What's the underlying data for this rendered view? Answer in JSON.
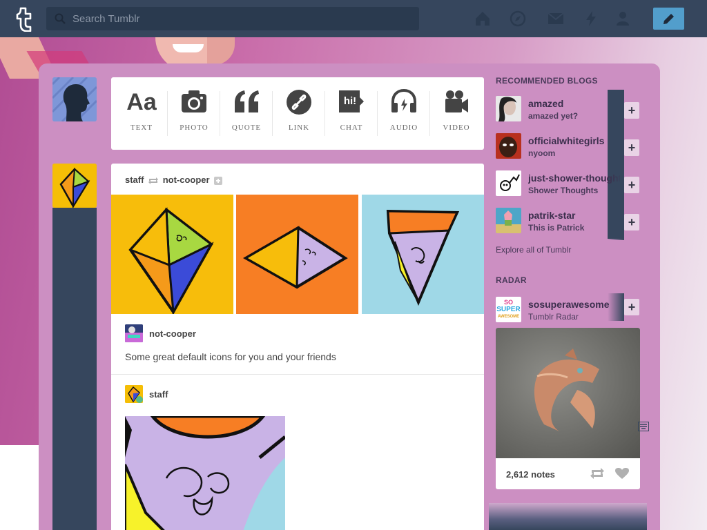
{
  "header": {
    "search_placeholder": "Search Tumblr",
    "nav_icons": [
      "home-icon",
      "explore-icon",
      "inbox-icon",
      "activity-icon",
      "account-icon"
    ],
    "compose_icon": "pencil-icon",
    "colors": {
      "header_bg": "#36465d",
      "compose_bg": "#529ecc"
    }
  },
  "composer": {
    "types": [
      {
        "id": "text",
        "label": "TEXT",
        "icon": "text-icon"
      },
      {
        "id": "photo",
        "label": "PHOTO",
        "icon": "camera-icon"
      },
      {
        "id": "quote",
        "label": "QUOTE",
        "icon": "quote-icon"
      },
      {
        "id": "link",
        "label": "LINK",
        "icon": "link-icon"
      },
      {
        "id": "chat",
        "label": "CHAT",
        "icon": "chat-icon"
      },
      {
        "id": "audio",
        "label": "AUDIO",
        "icon": "headphones-icon"
      },
      {
        "id": "video",
        "label": "VIDEO",
        "icon": "video-camera-icon"
      }
    ],
    "text_glyph": "Aa",
    "quote_glyph": "“",
    "chat_glyph": "hi!"
  },
  "post": {
    "author": "staff",
    "reblogged_from": "not-cooper",
    "source_blog": "not-cooper",
    "caption": "Some great default icons for you and your friends",
    "reblogger": "staff"
  },
  "sidebar": {
    "recommended_title": "RECOMMENDED BLOGS",
    "recommended": [
      {
        "name": "amazed",
        "subtitle": "amazed yet?"
      },
      {
        "name": "officialwhitegirls",
        "subtitle": "nyoom"
      },
      {
        "name": "just-shower-thoughts",
        "subtitle": "Shower Thoughts"
      },
      {
        "name": "patrik-star",
        "subtitle": "This is Patrick"
      }
    ],
    "follow_glyph": "+",
    "explore_link": "Explore all of Tumblr",
    "radar_title": "RADAR",
    "radar": {
      "name": "sosuperawesome",
      "subtitle": "Tumblr Radar",
      "avatar_text": [
        "SO",
        "SUPER",
        "AWESOME"
      ],
      "notes": "2,612 notes"
    }
  }
}
